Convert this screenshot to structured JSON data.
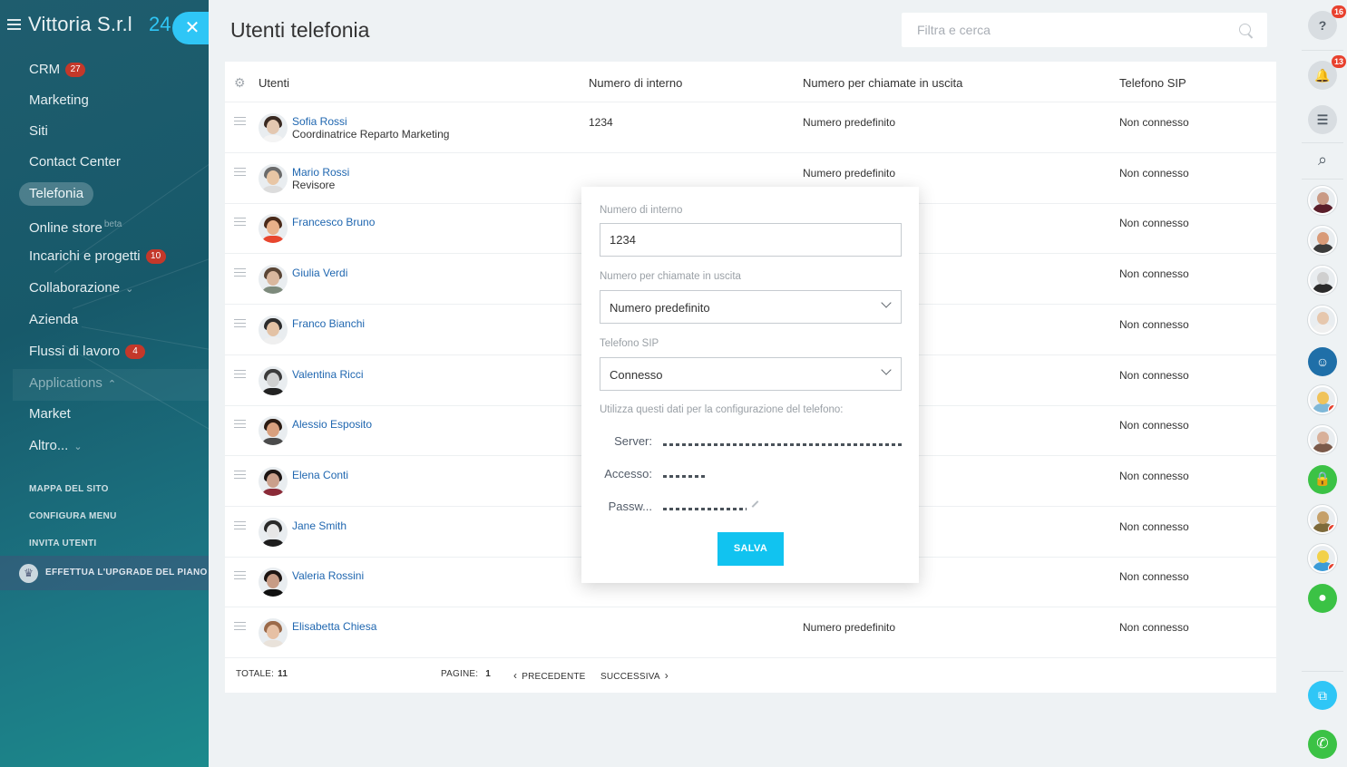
{
  "sidebar": {
    "company": "Vittoria S.r.l",
    "company_suffix": "24",
    "items": [
      {
        "label": "CRM",
        "badge": "27"
      },
      {
        "label": "Marketing"
      },
      {
        "label": "Siti"
      },
      {
        "label": "Contact Center"
      },
      {
        "label": "Telefonia",
        "active": true
      },
      {
        "label": "Online store",
        "sup": "beta"
      },
      {
        "label": "Incarichi e progetti",
        "badge": "10"
      },
      {
        "label": "Collaborazione"
      },
      {
        "label": "Azienda"
      },
      {
        "label": "Flussi di lavoro",
        "badge": "4"
      },
      {
        "label": "Applications"
      },
      {
        "label": "Market"
      },
      {
        "label": "Altro..."
      }
    ],
    "links": [
      "MAPPA DEL SITO",
      "CONFIGURA MENU",
      "INVITA UTENTI"
    ],
    "upgrade": "EFFETTUA L'UPGRADE DEL PIANO"
  },
  "header": {
    "title": "Utenti telefonia",
    "search_placeholder": "Filtra e cerca"
  },
  "table": {
    "columns": [
      "Utenti",
      "Numero di interno",
      "Numero per chiamate in uscita",
      "Telefono SIP"
    ],
    "rows": [
      {
        "name": "Sofia Rossi",
        "role": "Coordinatrice Reparto Marketing",
        "internal": "1234",
        "outgoing": "Numero predefinito",
        "sip": "Non connesso"
      },
      {
        "name": "Mario Rossi",
        "role": "Revisore",
        "internal": "",
        "outgoing": "Numero predefinito",
        "sip": "Non connesso"
      },
      {
        "name": "Francesco Bruno",
        "role": "",
        "internal": "",
        "outgoing": "",
        "sip": "Non connesso"
      },
      {
        "name": "Giulia Verdi",
        "role": "",
        "internal": "",
        "outgoing": "",
        "sip": "Non connesso"
      },
      {
        "name": "Franco Bianchi",
        "role": "",
        "internal": "",
        "outgoing": "",
        "sip": "Non connesso"
      },
      {
        "name": "Valentina Ricci",
        "role": "",
        "internal": "",
        "outgoing": "",
        "sip": "Non connesso"
      },
      {
        "name": "Alessio Esposito",
        "role": "",
        "internal": "",
        "outgoing": "",
        "sip": "Non connesso"
      },
      {
        "name": "Elena Conti",
        "role": "",
        "internal": "",
        "outgoing": "",
        "sip": "Non connesso"
      },
      {
        "name": "Jane Smith",
        "role": "",
        "internal": "",
        "outgoing": "",
        "sip": "Non connesso"
      },
      {
        "name": "Valeria Rossini",
        "role": "",
        "internal": "",
        "outgoing": "",
        "sip": "Non connesso"
      },
      {
        "name": "Elisabetta Chiesa",
        "role": "",
        "internal": "",
        "outgoing": "Numero predefinito",
        "sip": "Non connesso"
      }
    ],
    "footer": {
      "total_label": "TOTALE:",
      "total_value": "11",
      "pages_label": "PAGINE:",
      "pages_value": "1",
      "prev": "PRECEDENTE",
      "next": "SUCCESSIVA"
    }
  },
  "popup": {
    "internal_label": "Numero di interno",
    "internal_value": "1234",
    "outgoing_label": "Numero per chiamate in uscita",
    "outgoing_value": "Numero predefinito",
    "sip_label": "Telefono SIP",
    "sip_value": "Connesso",
    "config_hint": "Utilizza questi dati per la configurazione del telefono:",
    "server_label": "Server:",
    "login_label": "Accesso:",
    "password_label": "Passw...",
    "save_label": "SALVA"
  },
  "rightbar": {
    "help_badge": "16",
    "notifications_badge": "13"
  },
  "colors": {
    "accent": "#2fc6f6",
    "link": "#2067b0",
    "badge": "#c4382a",
    "green": "#3bc245"
  }
}
